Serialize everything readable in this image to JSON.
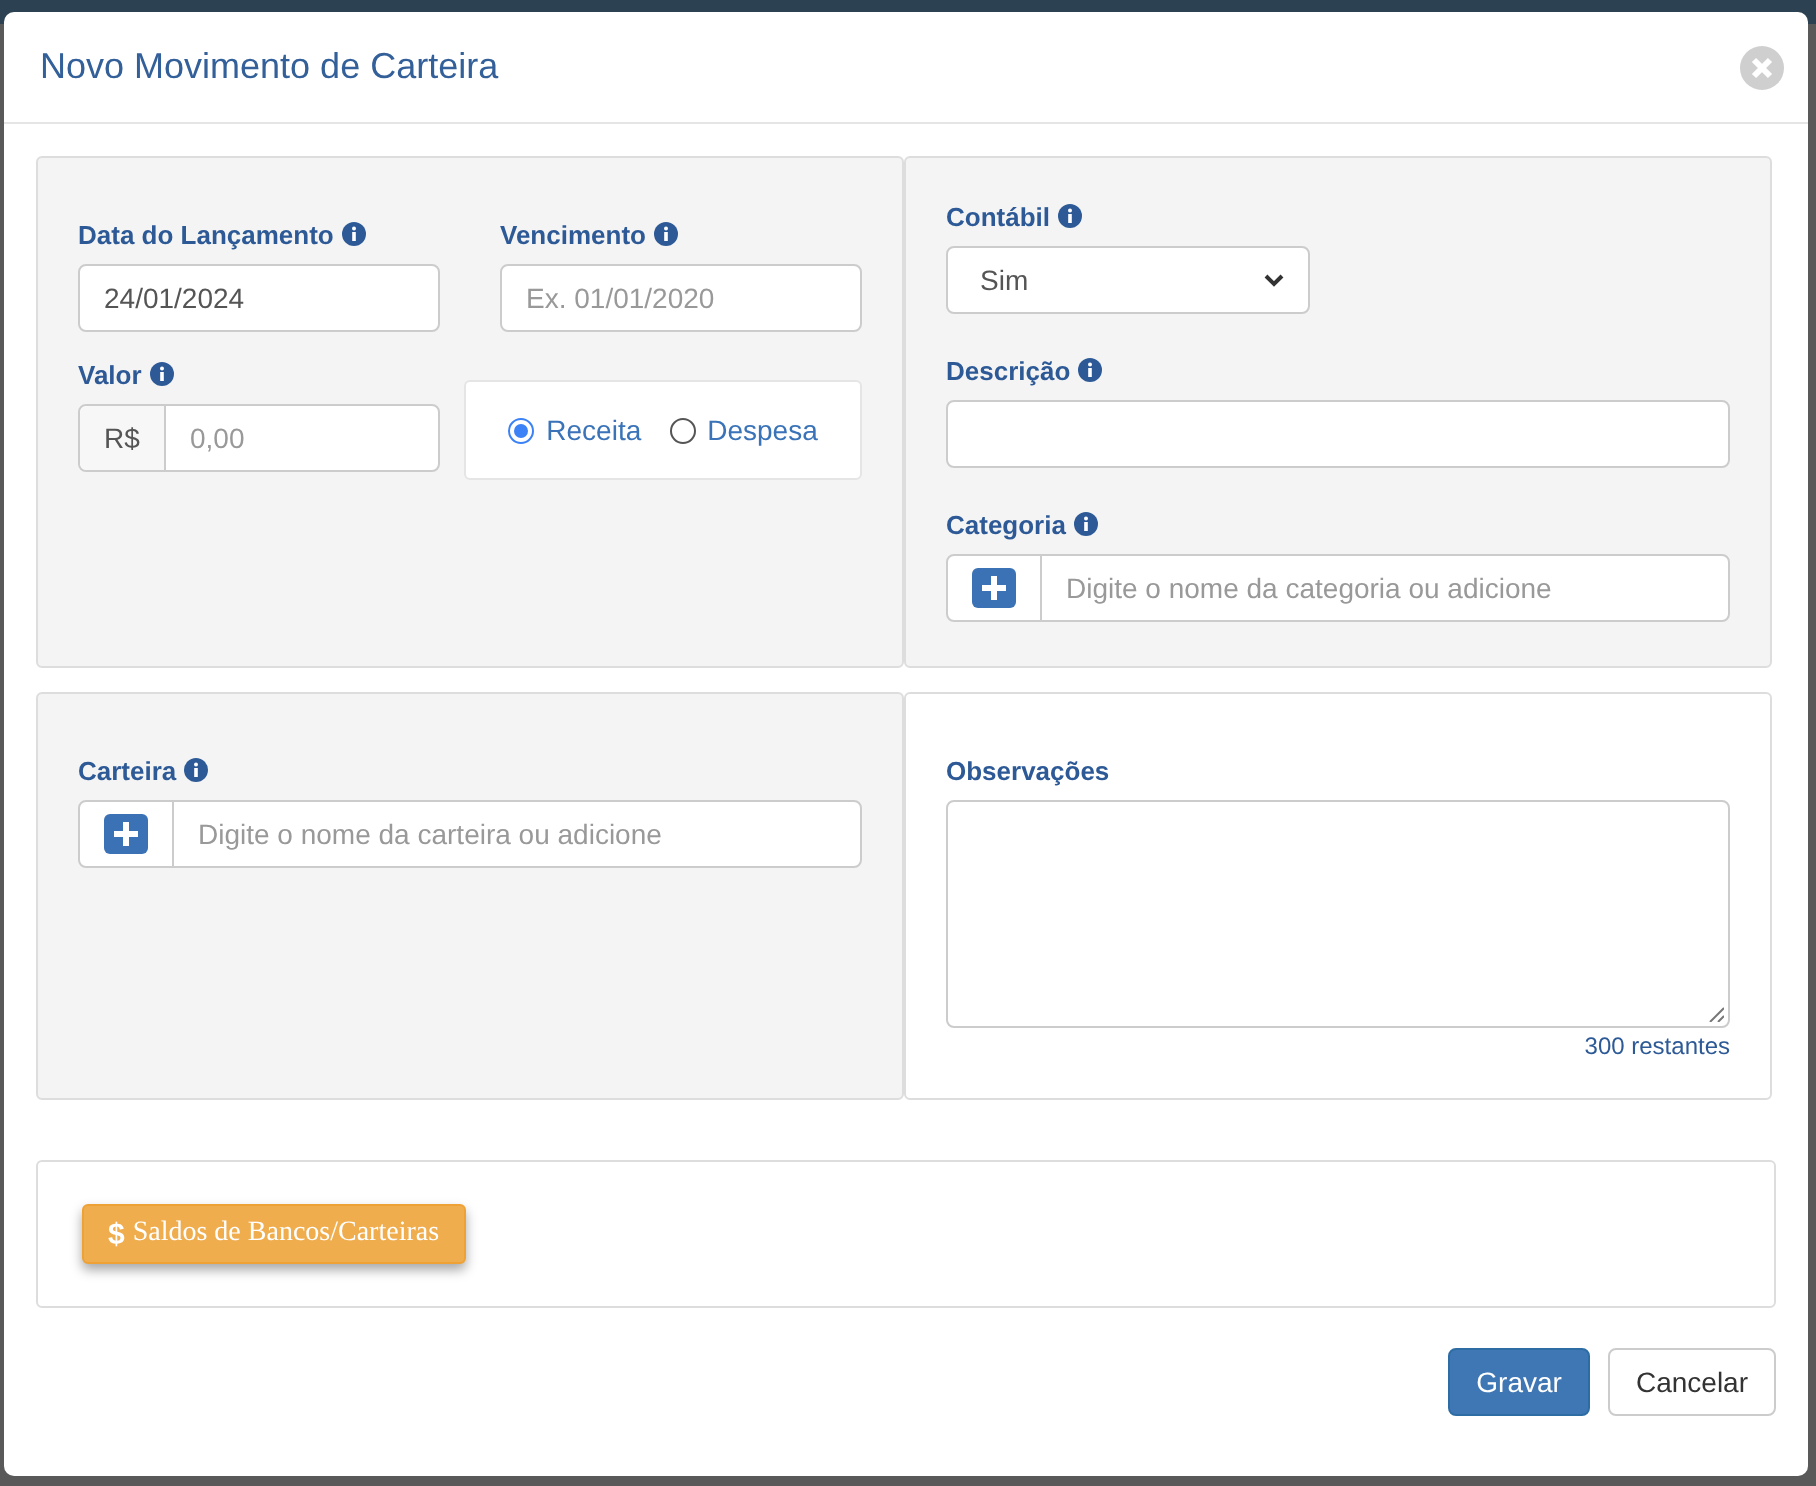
{
  "dialog": {
    "title": "Novo Movimento de Carteira"
  },
  "launch_date": {
    "label": "Data do Lançamento",
    "info": true,
    "value": "24/01/2024"
  },
  "due_date": {
    "label": "Vencimento",
    "info": true,
    "placeholder": "Ex. 01/01/2020"
  },
  "amount": {
    "label": "Valor",
    "info": true,
    "prefix": "R$",
    "placeholder": "0,00"
  },
  "type_options": [
    {
      "label": "Receita",
      "selected": true
    },
    {
      "label": "Despesa",
      "selected": false
    }
  ],
  "accounting": {
    "label": "Contábil",
    "info": true,
    "value": "Sim"
  },
  "description": {
    "label": "Descrição",
    "info": true
  },
  "category": {
    "label": "Categoria",
    "info": true,
    "placeholder": "Digite o nome da categoria ou adicione"
  },
  "wallet": {
    "label": "Carteira",
    "info": true,
    "placeholder": "Digite o nome da carteira ou adicione"
  },
  "notes": {
    "label": "Observações",
    "info": false,
    "remaining": "300 restantes"
  },
  "balance_button": {
    "icon": "$",
    "label": "Saldos de Bancos/Carteiras"
  },
  "buttons": [
    {
      "label": "Gravar",
      "kind": "primary"
    },
    {
      "label": "Cancelar",
      "kind": "default"
    }
  ]
}
